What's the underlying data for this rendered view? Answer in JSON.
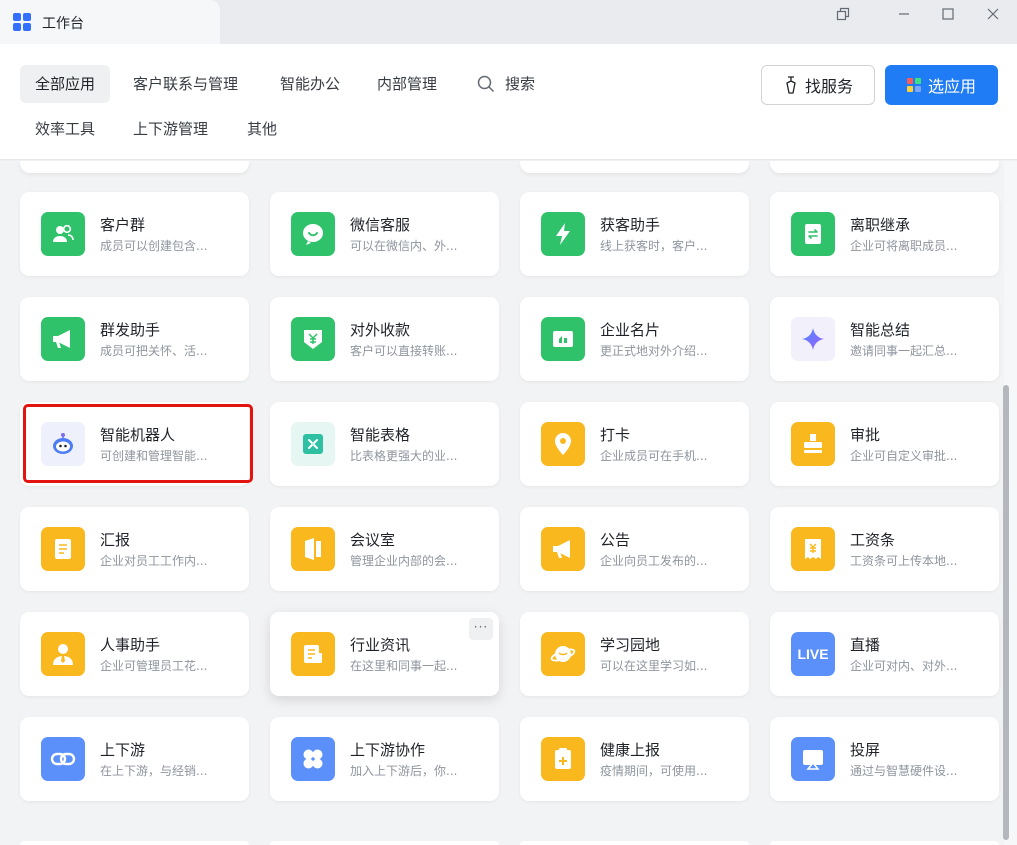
{
  "window": {
    "title": "工作台",
    "controls": [
      "restore-tab-icon",
      "minimize-icon",
      "maximize-icon",
      "close-icon"
    ]
  },
  "nav": {
    "tabs": [
      {
        "label": "全部应用",
        "active": true
      },
      {
        "label": "客户联系与管理"
      },
      {
        "label": "智能办公"
      },
      {
        "label": "内部管理"
      },
      {
        "label": "搜索",
        "icon": "search-icon"
      },
      {
        "label": "效率工具"
      },
      {
        "label": "上下游管理"
      },
      {
        "label": "其他"
      }
    ],
    "find_service": "找服务",
    "select_app": "选应用"
  },
  "colors": {
    "primary": "#1f7cf5",
    "green": "#34c759",
    "yellow": "#f9b81e",
    "blue": "#5b8ff9",
    "highlight": "#e3140f"
  },
  "apps": [
    {
      "title": "客户群",
      "desc": "成员可以创建包含...",
      "icon": "customer-group-icon",
      "color": "#2fc26b"
    },
    {
      "title": "微信客服",
      "desc": "可以在微信内、外...",
      "icon": "wechat-service-icon",
      "color": "#2fc26b"
    },
    {
      "title": "获客助手",
      "desc": "线上获客时，客户...",
      "icon": "lightning-icon",
      "color": "#2fc26b"
    },
    {
      "title": "离职继承",
      "desc": "企业可将离职成员...",
      "icon": "transfer-doc-icon",
      "color": "#2fc26b"
    },
    {
      "title": "群发助手",
      "desc": "成员可把关怀、活...",
      "icon": "megaphone-icon",
      "color": "#2fc26b"
    },
    {
      "title": "对外收款",
      "desc": "客户可以直接转账...",
      "icon": "yuan-shield-icon",
      "color": "#2fc26b"
    },
    {
      "title": "企业名片",
      "desc": "更正式地对外介绍...",
      "icon": "business-card-icon",
      "color": "#2fc26b"
    },
    {
      "title": "智能总结",
      "desc": "邀请同事一起汇总...",
      "icon": "sparkle-icon",
      "color": "#f1f0fb"
    },
    {
      "title": "智能机器人",
      "desc": "可创建和管理智能...",
      "icon": "robot-icon",
      "color": "#eef0fb"
    },
    {
      "title": "智能表格",
      "desc": "比表格更强大的业...",
      "icon": "smart-sheet-icon",
      "color": "#e6f7f3"
    },
    {
      "title": "打卡",
      "desc": "企业成员可在手机...",
      "icon": "location-pin-icon",
      "color": "#f9b81e"
    },
    {
      "title": "审批",
      "desc": "企业可自定义审批...",
      "icon": "stamp-icon",
      "color": "#f9b81e"
    },
    {
      "title": "汇报",
      "desc": "企业对员工工作内...",
      "icon": "report-doc-icon",
      "color": "#f9b81e"
    },
    {
      "title": "会议室",
      "desc": "管理企业内部的会...",
      "icon": "door-icon",
      "color": "#f9b81e"
    },
    {
      "title": "公告",
      "desc": "企业向员工发布的...",
      "icon": "bullhorn-icon",
      "color": "#f9b81e"
    },
    {
      "title": "工资条",
      "desc": "工资条可上传本地...",
      "icon": "payslip-icon",
      "color": "#f9b81e"
    },
    {
      "title": "人事助手",
      "desc": "企业可管理员工花...",
      "icon": "person-tie-icon",
      "color": "#f9b81e"
    },
    {
      "title": "行业资讯",
      "desc": "在这里和同事一起...",
      "icon": "news-icon",
      "color": "#f9b81e",
      "more": "···"
    },
    {
      "title": "学习园地",
      "desc": "可以在这里学习如...",
      "icon": "planet-icon",
      "color": "#f9b81e"
    },
    {
      "title": "直播",
      "desc": "企业可对内、对外...",
      "icon": "live-icon",
      "color": "#5b8ff9",
      "icon_text": "LIVE"
    },
    {
      "title": "上下游",
      "desc": "在上下游，与经销...",
      "icon": "link-chain-icon",
      "color": "#5b8ff9"
    },
    {
      "title": "上下游协作",
      "desc": "加入上下游后，你...",
      "icon": "four-petal-icon",
      "color": "#5b8ff9"
    },
    {
      "title": "健康上报",
      "desc": "疫情期间，可使用...",
      "icon": "health-clipboard-icon",
      "color": "#f9b81e"
    },
    {
      "title": "投屏",
      "desc": "通过与智慧硬件设...",
      "icon": "screen-cast-icon",
      "color": "#5b8ff9"
    }
  ]
}
